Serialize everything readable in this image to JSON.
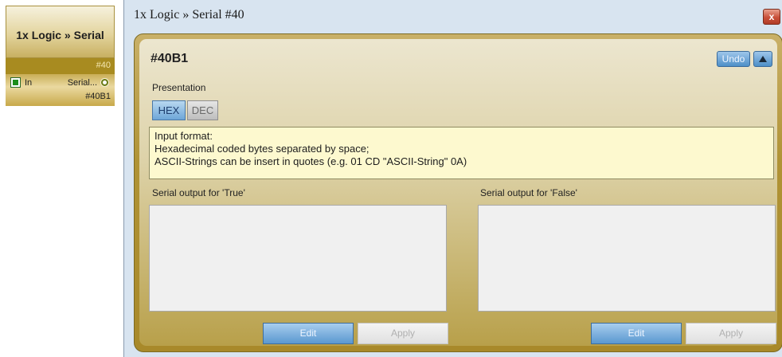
{
  "node": {
    "title": "1x Logic » Serial",
    "id": "#40",
    "input_label": "In",
    "output_label": "Serial...",
    "output_id": "#40B1"
  },
  "window": {
    "title": "1x Logic » Serial #40",
    "close_label": "x"
  },
  "panel": {
    "heading": "#40B1",
    "undo_label": "Undo",
    "presentation_label": "Presentation",
    "hex_label": "HEX",
    "dec_label": "DEC",
    "selected_format": "HEX",
    "info_lines": [
      "Input format:",
      "Hexadecimal coded bytes separated by space;",
      "ASCII-Strings can be insert in quotes  (e.g. 01 CD \"ASCII-String\" 0A)"
    ],
    "true_output": {
      "label": "Serial output for 'True'",
      "value": "",
      "edit_label": "Edit",
      "apply_label": "Apply"
    },
    "false_output": {
      "label": "Serial output for 'False'",
      "value": "",
      "edit_label": "Edit",
      "apply_label": "Apply"
    }
  },
  "colors": {
    "panel_gold": "#b09335",
    "button_blue": "#5a98d0",
    "info_background": "#fdf9cf"
  },
  "icons": {
    "input_port": "input-port-icon",
    "output_port": "output-port-icon",
    "close": "close-icon",
    "collapse": "collapse-up-icon"
  }
}
